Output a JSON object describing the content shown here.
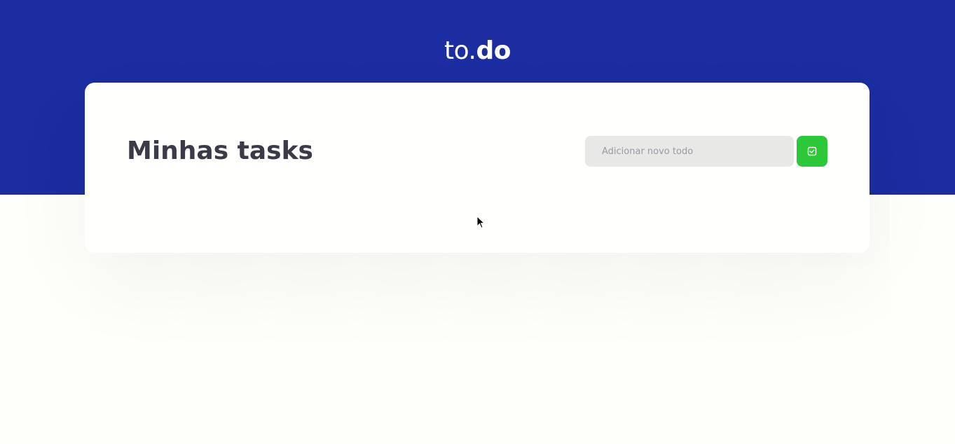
{
  "header": {
    "logo_light": "to.",
    "logo_bold": "do",
    "background_color": "#1c2ca1"
  },
  "main": {
    "title": "Minhas tasks",
    "new_todo": {
      "value": "",
      "placeholder": "Adicionar novo todo"
    },
    "add_button": {
      "icon": "check-square-icon",
      "color": "#2cc837"
    }
  }
}
